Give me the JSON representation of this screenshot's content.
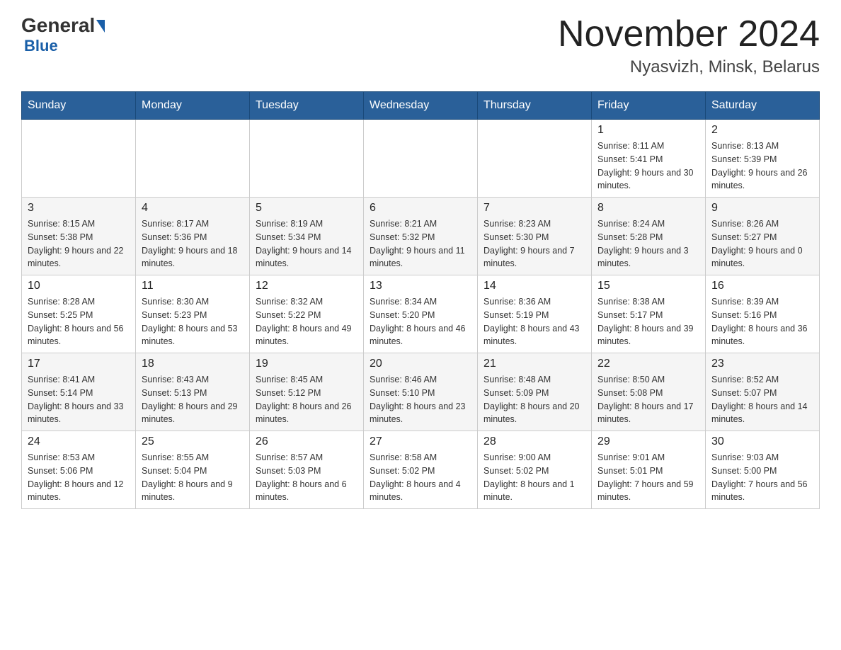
{
  "header": {
    "logo_general": "General",
    "logo_blue": "Blue",
    "month_title": "November 2024",
    "location": "Nyasvizh, Minsk, Belarus"
  },
  "weekdays": [
    "Sunday",
    "Monday",
    "Tuesday",
    "Wednesday",
    "Thursday",
    "Friday",
    "Saturday"
  ],
  "rows": [
    {
      "cells": [
        {
          "day": "",
          "info": ""
        },
        {
          "day": "",
          "info": ""
        },
        {
          "day": "",
          "info": ""
        },
        {
          "day": "",
          "info": ""
        },
        {
          "day": "",
          "info": ""
        },
        {
          "day": "1",
          "info": "Sunrise: 8:11 AM\nSunset: 5:41 PM\nDaylight: 9 hours and 30 minutes."
        },
        {
          "day": "2",
          "info": "Sunrise: 8:13 AM\nSunset: 5:39 PM\nDaylight: 9 hours and 26 minutes."
        }
      ]
    },
    {
      "cells": [
        {
          "day": "3",
          "info": "Sunrise: 8:15 AM\nSunset: 5:38 PM\nDaylight: 9 hours and 22 minutes."
        },
        {
          "day": "4",
          "info": "Sunrise: 8:17 AM\nSunset: 5:36 PM\nDaylight: 9 hours and 18 minutes."
        },
        {
          "day": "5",
          "info": "Sunrise: 8:19 AM\nSunset: 5:34 PM\nDaylight: 9 hours and 14 minutes."
        },
        {
          "day": "6",
          "info": "Sunrise: 8:21 AM\nSunset: 5:32 PM\nDaylight: 9 hours and 11 minutes."
        },
        {
          "day": "7",
          "info": "Sunrise: 8:23 AM\nSunset: 5:30 PM\nDaylight: 9 hours and 7 minutes."
        },
        {
          "day": "8",
          "info": "Sunrise: 8:24 AM\nSunset: 5:28 PM\nDaylight: 9 hours and 3 minutes."
        },
        {
          "day": "9",
          "info": "Sunrise: 8:26 AM\nSunset: 5:27 PM\nDaylight: 9 hours and 0 minutes."
        }
      ]
    },
    {
      "cells": [
        {
          "day": "10",
          "info": "Sunrise: 8:28 AM\nSunset: 5:25 PM\nDaylight: 8 hours and 56 minutes."
        },
        {
          "day": "11",
          "info": "Sunrise: 8:30 AM\nSunset: 5:23 PM\nDaylight: 8 hours and 53 minutes."
        },
        {
          "day": "12",
          "info": "Sunrise: 8:32 AM\nSunset: 5:22 PM\nDaylight: 8 hours and 49 minutes."
        },
        {
          "day": "13",
          "info": "Sunrise: 8:34 AM\nSunset: 5:20 PM\nDaylight: 8 hours and 46 minutes."
        },
        {
          "day": "14",
          "info": "Sunrise: 8:36 AM\nSunset: 5:19 PM\nDaylight: 8 hours and 43 minutes."
        },
        {
          "day": "15",
          "info": "Sunrise: 8:38 AM\nSunset: 5:17 PM\nDaylight: 8 hours and 39 minutes."
        },
        {
          "day": "16",
          "info": "Sunrise: 8:39 AM\nSunset: 5:16 PM\nDaylight: 8 hours and 36 minutes."
        }
      ]
    },
    {
      "cells": [
        {
          "day": "17",
          "info": "Sunrise: 8:41 AM\nSunset: 5:14 PM\nDaylight: 8 hours and 33 minutes."
        },
        {
          "day": "18",
          "info": "Sunrise: 8:43 AM\nSunset: 5:13 PM\nDaylight: 8 hours and 29 minutes."
        },
        {
          "day": "19",
          "info": "Sunrise: 8:45 AM\nSunset: 5:12 PM\nDaylight: 8 hours and 26 minutes."
        },
        {
          "day": "20",
          "info": "Sunrise: 8:46 AM\nSunset: 5:10 PM\nDaylight: 8 hours and 23 minutes."
        },
        {
          "day": "21",
          "info": "Sunrise: 8:48 AM\nSunset: 5:09 PM\nDaylight: 8 hours and 20 minutes."
        },
        {
          "day": "22",
          "info": "Sunrise: 8:50 AM\nSunset: 5:08 PM\nDaylight: 8 hours and 17 minutes."
        },
        {
          "day": "23",
          "info": "Sunrise: 8:52 AM\nSunset: 5:07 PM\nDaylight: 8 hours and 14 minutes."
        }
      ]
    },
    {
      "cells": [
        {
          "day": "24",
          "info": "Sunrise: 8:53 AM\nSunset: 5:06 PM\nDaylight: 8 hours and 12 minutes."
        },
        {
          "day": "25",
          "info": "Sunrise: 8:55 AM\nSunset: 5:04 PM\nDaylight: 8 hours and 9 minutes."
        },
        {
          "day": "26",
          "info": "Sunrise: 8:57 AM\nSunset: 5:03 PM\nDaylight: 8 hours and 6 minutes."
        },
        {
          "day": "27",
          "info": "Sunrise: 8:58 AM\nSunset: 5:02 PM\nDaylight: 8 hours and 4 minutes."
        },
        {
          "day": "28",
          "info": "Sunrise: 9:00 AM\nSunset: 5:02 PM\nDaylight: 8 hours and 1 minute."
        },
        {
          "day": "29",
          "info": "Sunrise: 9:01 AM\nSunset: 5:01 PM\nDaylight: 7 hours and 59 minutes."
        },
        {
          "day": "30",
          "info": "Sunrise: 9:03 AM\nSunset: 5:00 PM\nDaylight: 7 hours and 56 minutes."
        }
      ]
    }
  ]
}
